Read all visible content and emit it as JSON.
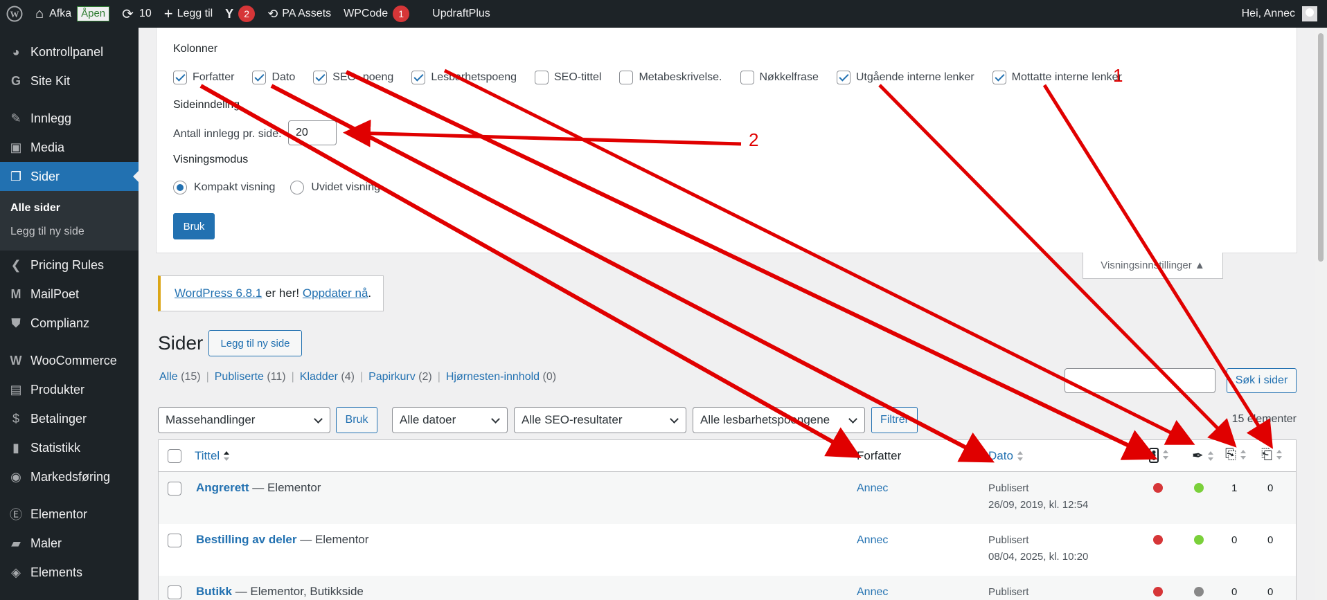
{
  "adminbar": {
    "site": "Afka",
    "open_badge": "Åpen",
    "updates": "10",
    "new": "Legg til",
    "yoast_count": "2",
    "pa_assets": "PA Assets",
    "wpcode": "WPCode",
    "wpcode_count": "1",
    "updraft": "UpdraftPlus",
    "greeting": "Hei, Annec"
  },
  "sidebar": {
    "items": [
      {
        "label": "Kontrollpanel",
        "icon": "dashboard-icon"
      },
      {
        "label": "Site Kit",
        "icon": "google-icon"
      },
      {
        "label": "Innlegg",
        "icon": "pin-icon"
      },
      {
        "label": "Media",
        "icon": "media-icon"
      },
      {
        "label": "Sider",
        "icon": "pages-icon"
      }
    ],
    "sub": [
      "Alle sider",
      "Legg til ny side"
    ],
    "items2": [
      {
        "label": "Pricing Rules",
        "icon": "chevron-icon"
      },
      {
        "label": "MailPoet",
        "icon": "mailpoet-icon"
      },
      {
        "label": "Complianz",
        "icon": "shield-icon"
      },
      {
        "label": "WooCommerce",
        "icon": "woo-icon"
      },
      {
        "label": "Produkter",
        "icon": "archive-icon"
      },
      {
        "label": "Betalinger",
        "icon": "dollar-icon"
      },
      {
        "label": "Statistikk",
        "icon": "chart-icon"
      },
      {
        "label": "Markedsføring",
        "icon": "megaphone-icon"
      },
      {
        "label": "Elementor",
        "icon": "elementor-icon"
      },
      {
        "label": "Maler",
        "icon": "folder-icon"
      },
      {
        "label": "Elements",
        "icon": "elements-icon"
      }
    ]
  },
  "screen_options": {
    "columns_heading": "Kolonner",
    "columns": [
      {
        "label": "Forfatter",
        "checked": true
      },
      {
        "label": "Dato",
        "checked": true
      },
      {
        "label": "SEO -poeng",
        "checked": true
      },
      {
        "label": "Lesbarhetspoeng",
        "checked": true
      },
      {
        "label": "SEO-tittel",
        "checked": false
      },
      {
        "label": "Metabeskrivelse.",
        "checked": false
      },
      {
        "label": "Nøkkelfrase",
        "checked": false
      },
      {
        "label": "Utgående interne lenker",
        "checked": true
      },
      {
        "label": "Mottatte interne lenker",
        "checked": true
      }
    ],
    "pagination_heading": "Sideinndeling",
    "per_page_label": "Antall innlegg pr. side:",
    "per_page_value": "20",
    "view_heading": "Visningsmodus",
    "view_compact": "Kompakt visning",
    "view_extended": "Uvidet visning",
    "apply": "Bruk",
    "tab": "Visningsinnstillinger ▲"
  },
  "annotations": {
    "one": "1",
    "two": "2"
  },
  "notice": {
    "link": "WordPress 6.8.1",
    "text": " er her! ",
    "update": "Oppdater nå",
    "end": "."
  },
  "page": {
    "title": "Sider",
    "add_new": "Legg til ny side"
  },
  "filters": [
    {
      "label": "Alle",
      "count": "(15)"
    },
    {
      "label": "Publiserte",
      "count": "(11)"
    },
    {
      "label": "Kladder",
      "count": "(4)"
    },
    {
      "label": "Papirkurv",
      "count": "(2)"
    },
    {
      "label": "Hjørnesten-innhold",
      "count": "(0)"
    }
  ],
  "search": {
    "button": "Søk i sider",
    "value": ""
  },
  "tablenav": {
    "bulk": "Massehandlinger",
    "apply": "Bruk",
    "dates": "Alle datoer",
    "seo": "Alle SEO-resultater",
    "readability": "Alle lesbarhetspoengene",
    "filter": "Filtrer",
    "count": "15 elementer"
  },
  "columns": {
    "title": "Tittel",
    "author": "Forfatter",
    "date": "Dato"
  },
  "rows": [
    {
      "title": "Angrerett",
      "suffix": " — Elementor",
      "author": "Annec",
      "status": "Publisert",
      "date": "26/09, 2019, kl. 12:54",
      "seo": "#d63638",
      "read": "#7ad03a",
      "out": "1",
      "in": "0"
    },
    {
      "title": "Bestilling av deler",
      "suffix": " — Elementor",
      "author": "Annec",
      "status": "Publisert",
      "date": "08/04, 2025, kl. 10:20",
      "seo": "#d63638",
      "read": "#7ad03a",
      "out": "0",
      "in": "0"
    },
    {
      "title": "Butikk",
      "suffix": " — Elementor, Butikkside",
      "author": "Annec",
      "status": "Publisert",
      "date": "",
      "seo": "#d63638",
      "read": "#888888",
      "out": "0",
      "in": "0"
    }
  ]
}
